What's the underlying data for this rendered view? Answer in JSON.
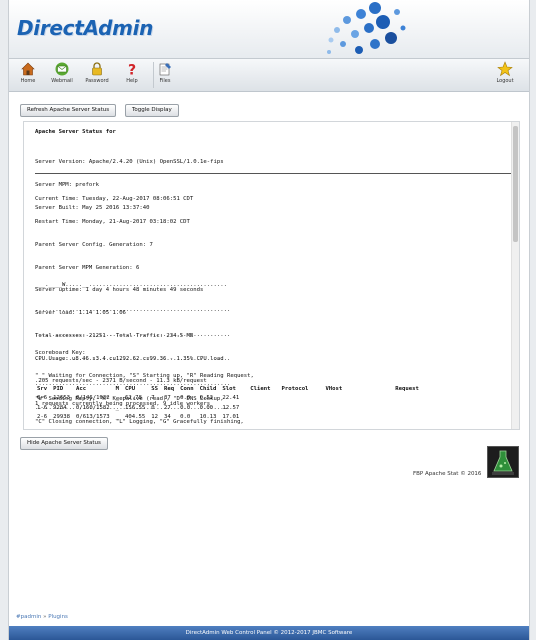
{
  "header": {
    "brand": "DirectAdmin"
  },
  "toolbar": [
    {
      "label": "Home",
      "icon": "home-icon"
    },
    {
      "label": "Webmail",
      "icon": "webmail-icon"
    },
    {
      "label": "Password",
      "icon": "lock-icon"
    },
    {
      "label": "Help",
      "icon": "help-icon"
    },
    {
      "label": "Files",
      "icon": "files-icon"
    },
    {
      "label": "Logout",
      "icon": "logout-icon"
    }
  ],
  "buttons": {
    "refresh": "Refresh Apache Server Status",
    "toggle": "Toggle Display",
    "hide": "Hide Apache Server Status"
  },
  "status": {
    "title": "Apache Server Status for",
    "server_info": [
      "Server Version: Apache/2.4.20 (Unix) OpenSSL/1.0.1e-fips",
      "Server MPM: prefork",
      "Server Built: May 25 2016 13:37:40"
    ],
    "metrics": [
      "Current Time: Tuesday, 22-Aug-2017 08:06:51 CDT",
      "Restart Time: Monday, 21-Aug-2017 03:18:02 CDT",
      "Parent Server Config. Generation: 7",
      "Parent Server MPM Generation: 6",
      "Server uptime: 1 day 4 hours 48 minutes 49 seconds",
      "Server load: 1.14 1.05 1.06",
      "Total accesses: 21251 - Total Traffic: 234.5 MB",
      "CPU Usage: u8.46 s3.4 cu1292.62 cs99.36 - 1.35% CPU load",
      ".205 requests/sec - 2371 B/second - 11.3 kB/request",
      "1 requests currently being processed, 9 idle workers"
    ],
    "scoreboard": [
      "___.____W.....__.........................................",
      "..........................................................",
      "..........................................................",
      "..........................................................",
      "..........................................................",
      ".........................................................",
      ".."
    ],
    "key": [
      "Scoreboard Key:",
      "\"_\" Waiting for Connection, \"S\" Starting up, \"R\" Reading Request,",
      "\"W\" Sending Reply, \"K\" Keepalive (read), \"D\" DNS Lookup,",
      "\"C\" Closing connection, \"L\" Logging, \"G\" Gracefully finishing,",
      "\"I\" Idle cleanup of worker, \".\" Open slot with no current process"
    ],
    "columns": [
      "Srv",
      "PID",
      "Acc",
      "M",
      "CPU",
      "SS",
      "Req",
      "Conn",
      "Child",
      "Slot",
      "Client",
      "Protocol",
      "VHost",
      "Request"
    ],
    "rows": [
      [
        "0-6",
        "12653",
        "0/146/1932",
        "_",
        "62.78",
        "7",
        "37",
        "0.0",
        "0.52",
        "22.41",
        "",
        "",
        "",
        ""
      ],
      [
        "1-6",
        "9284",
        "0/160/1582",
        "_",
        "156.55",
        "0",
        "27",
        "0.0",
        "0.00",
        "12.57",
        "",
        "",
        "",
        ""
      ],
      [
        "2-6",
        "29938",
        "0/613/1573",
        "_",
        "404.55",
        "12",
        "34",
        "0.0",
        "10.13",
        "17.01",
        "",
        "",
        "",
        ""
      ]
    ]
  },
  "footer": {
    "credit": "FBP Apache Stat © 2016",
    "breadcrumb_root": "#padmin",
    "breadcrumb_sep": "»",
    "breadcrumb_current": "Plugins",
    "copyright": "DirectAdmin Web Control Panel © 2012-2017 JBMC Software"
  },
  "colors": {
    "brand": "#1b63b3",
    "bottombar": "#2b5796"
  }
}
